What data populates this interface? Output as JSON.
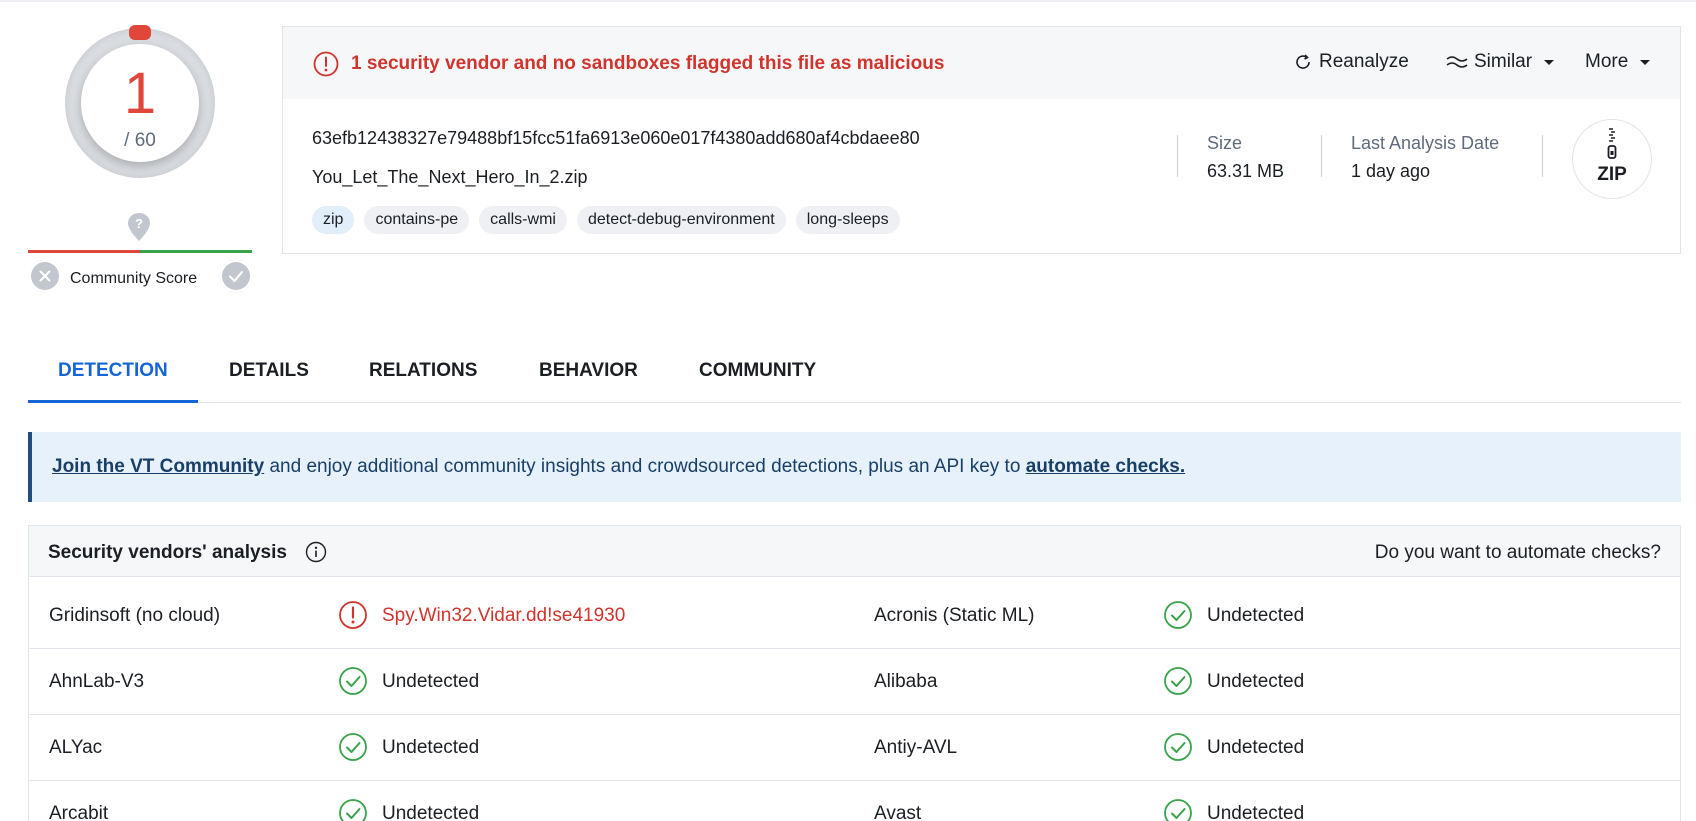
{
  "score": {
    "detections": "1",
    "total": "/ 60",
    "accent": "#e0463a"
  },
  "community": {
    "label": "Community Score"
  },
  "summary": {
    "alert": "1 security vendor and no sandboxes flagged this file as malicious",
    "actions": {
      "reanalyze": "Reanalyze",
      "similar": "Similar",
      "more": "More"
    },
    "hash": "63efb12438327e79488bf15fcc51fa6913e060e017f4380add680af4cbdaee80",
    "filename": "You_Let_The_Next_Hero_In_2.zip",
    "tags": [
      "zip",
      "contains-pe",
      "calls-wmi",
      "detect-debug-environment",
      "long-sleeps"
    ],
    "size_label": "Size",
    "size_value": "63.31 MB",
    "date_label": "Last Analysis Date",
    "date_value": "1 day ago",
    "filetype": "ZIP"
  },
  "tabs": [
    "DETECTION",
    "DETAILS",
    "RELATIONS",
    "BEHAVIOR",
    "COMMUNITY"
  ],
  "banner": {
    "link1": "Join the VT Community",
    "text": " and enjoy additional community insights and crowdsourced detections, plus an API key to ",
    "link2": "automate checks."
  },
  "vendors": {
    "title": "Security vendors' analysis",
    "automate": "Do you want to automate checks?",
    "rows": [
      [
        {
          "name": "Gridinsoft (no cloud)",
          "result": "Spy.Win32.Vidar.dd!se41930",
          "status": "malicious"
        },
        {
          "name": "Acronis (Static ML)",
          "result": "Undetected",
          "status": "undetected"
        }
      ],
      [
        {
          "name": "AhnLab-V3",
          "result": "Undetected",
          "status": "undetected"
        },
        {
          "name": "Alibaba",
          "result": "Undetected",
          "status": "undetected"
        }
      ],
      [
        {
          "name": "ALYac",
          "result": "Undetected",
          "status": "undetected"
        },
        {
          "name": "Antiy-AVL",
          "result": "Undetected",
          "status": "undetected"
        }
      ],
      [
        {
          "name": "Arcabit",
          "result": "Undetected",
          "status": "undetected"
        },
        {
          "name": "Avast",
          "result": "Undetected",
          "status": "undetected"
        }
      ]
    ]
  }
}
